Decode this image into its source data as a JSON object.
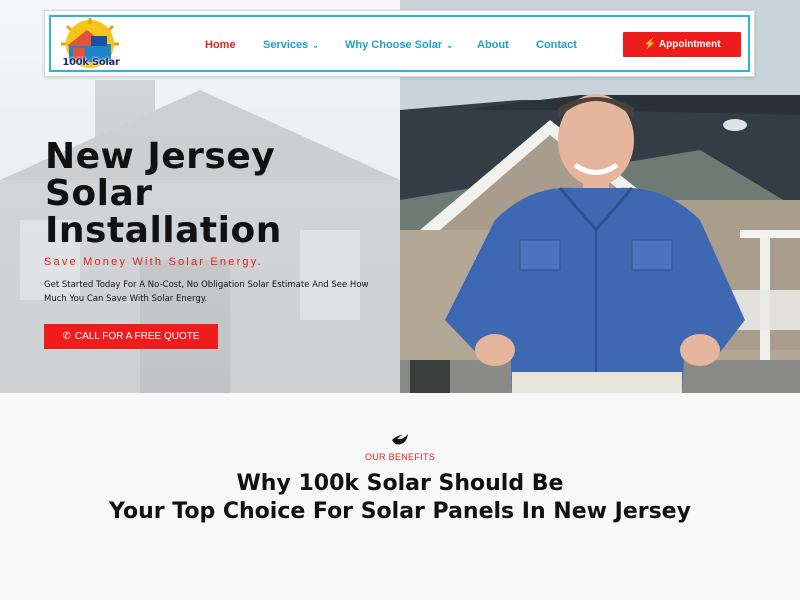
{
  "header": {
    "logo_text": "100k Solar",
    "menu": [
      {
        "label": "Home",
        "active": true,
        "dropdown": false
      },
      {
        "label": "Services",
        "active": false,
        "dropdown": true
      },
      {
        "label": "Why Choose Solar",
        "active": false,
        "dropdown": true
      },
      {
        "label": "About",
        "active": false,
        "dropdown": false
      },
      {
        "label": "Contact",
        "active": false,
        "dropdown": false
      }
    ],
    "cta_label": "Appointment",
    "cta_icon": "bolt-icon"
  },
  "hero": {
    "title_lines": [
      "New Jersey",
      "Solar",
      "Installation"
    ],
    "subtitle": "Save Money With Solar Energy.",
    "description": "Get Started Today For A No-Cost, No Obligation Solar Estimate And See How Much You Can Save With Solar Energy.",
    "button_label": "CALL FOR A FREE QUOTE",
    "button_icon": "phone-icon"
  },
  "benefits": {
    "icon": "leaf-icon",
    "eyebrow": "OUR BENEFITS",
    "title_lines": [
      "Why 100k Solar Should Be",
      "Your Top Choice For Solar Panels In New Jersey"
    ]
  },
  "colors": {
    "accent_red": "#ee1c1c",
    "link_blue": "#1fa0c8",
    "nav_border": "#2bb5d6",
    "text_dark": "#111111"
  }
}
